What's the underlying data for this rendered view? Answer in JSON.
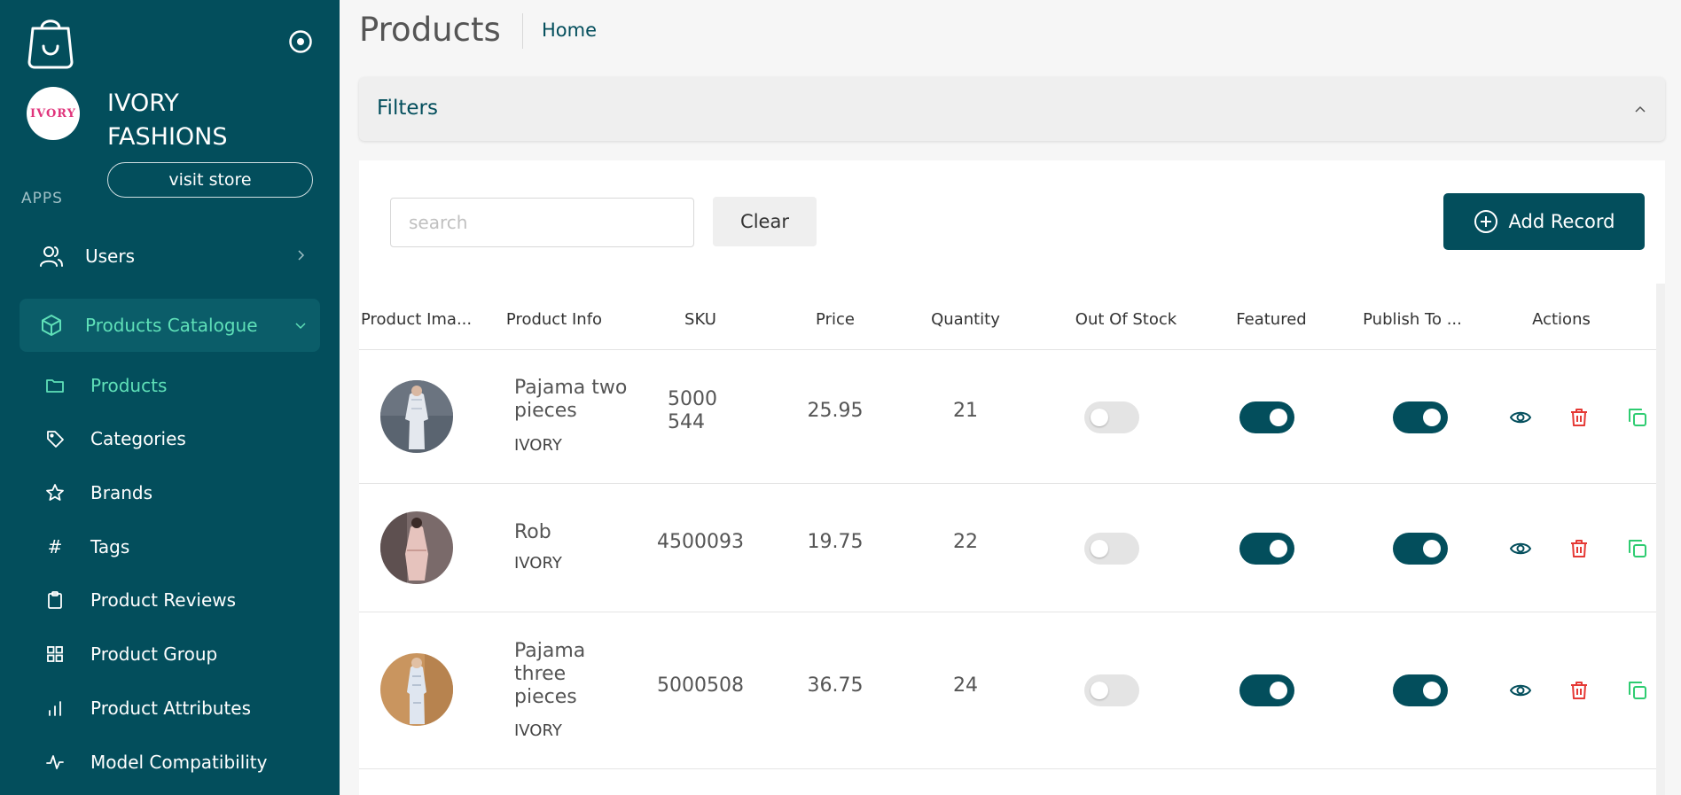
{
  "sidebar": {
    "store": {
      "avatar_text": "IVORY",
      "name": "IVORY FASHIONS",
      "visit_label": "visit store"
    },
    "section_label": "APPS",
    "nav": {
      "users": "Users",
      "products_catalogue": "Products Catalogue"
    },
    "sub_items": [
      {
        "label": "Products",
        "icon": "folder-icon"
      },
      {
        "label": "Categories",
        "icon": "tag-icon"
      },
      {
        "label": "Brands",
        "icon": "star-icon"
      },
      {
        "label": "Tags",
        "icon": "hash-icon"
      },
      {
        "label": "Product Reviews",
        "icon": "clipboard-icon"
      },
      {
        "label": "Product Group",
        "icon": "grid-icon"
      },
      {
        "label": "Product Attributes",
        "icon": "bar-chart-icon"
      },
      {
        "label": "Model Compatibility",
        "icon": "activity-icon"
      }
    ]
  },
  "header": {
    "title": "Products",
    "breadcrumb": "Home"
  },
  "filters": {
    "label": "Filters"
  },
  "toolbar": {
    "search_placeholder": "search",
    "clear_label": "Clear",
    "add_label": "Add Record"
  },
  "table": {
    "columns": [
      "Product Ima...",
      "Product Info",
      "SKU",
      "Price",
      "Quantity",
      "Out Of Stock",
      "Featured",
      "Publish To ...",
      "Actions"
    ],
    "rows": [
      {
        "name": "Pajama two pieces",
        "brand": "IVORY",
        "sku": "5000544",
        "price": "25.95",
        "quantity": "21",
        "out_of_stock": false,
        "featured": true,
        "publish": true
      },
      {
        "name": "Rob",
        "brand": "IVORY",
        "sku": "4500093",
        "price": "19.75",
        "quantity": "22",
        "out_of_stock": false,
        "featured": true,
        "publish": true
      },
      {
        "name": "Pajama three pieces",
        "brand": "IVORY",
        "sku": "5000508",
        "price": "36.75",
        "quantity": "24",
        "out_of_stock": false,
        "featured": true,
        "publish": true
      }
    ]
  },
  "colors": {
    "sidebar_bg": "#034e5c",
    "accent": "#5fe0b8",
    "primary": "#034e5c",
    "delete": "#e53935",
    "copy": "#2ecc71"
  }
}
